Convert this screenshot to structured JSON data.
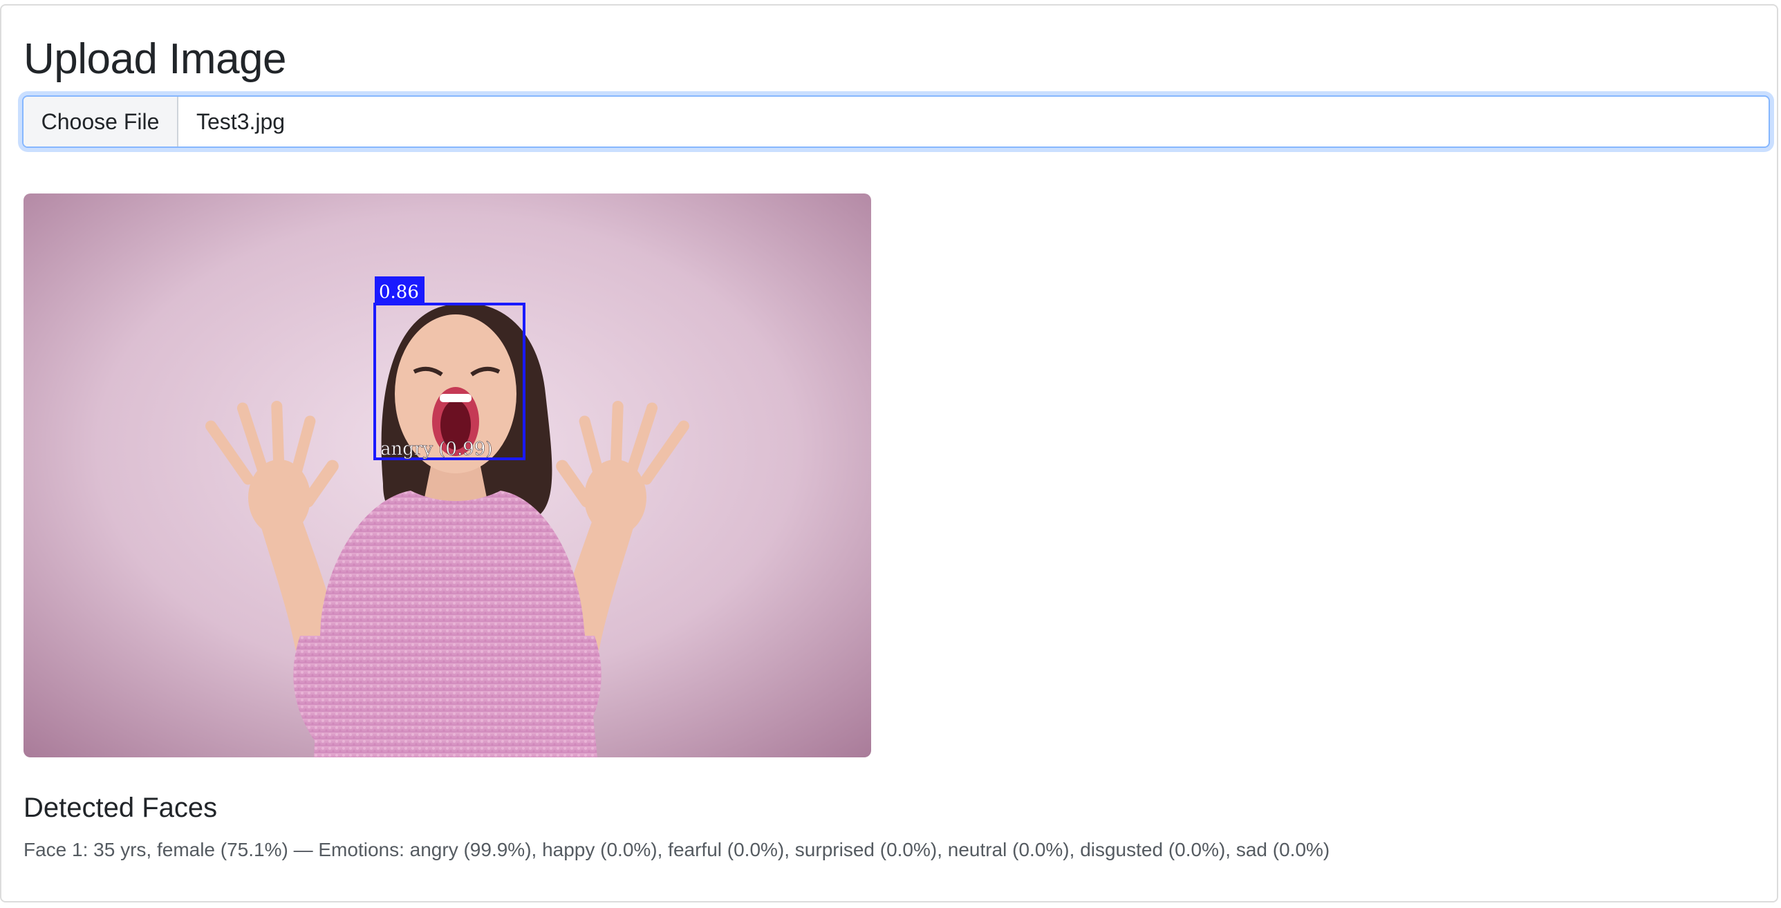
{
  "upload": {
    "title": "Upload Image",
    "button_label": "Choose File",
    "file_name": "Test3.jpg"
  },
  "image": {
    "detection_score": "0.86",
    "emotion_label": "angry (0.99)",
    "box_color": "#1a1aff"
  },
  "results": {
    "heading": "Detected Faces",
    "faces": [
      "Face 1: 35 yrs, female (75.1%) — Emotions: angry (99.9%), happy (0.0%), fearful (0.0%), surprised (0.0%), neutral (0.0%), disgusted (0.0%), sad (0.0%)"
    ]
  }
}
